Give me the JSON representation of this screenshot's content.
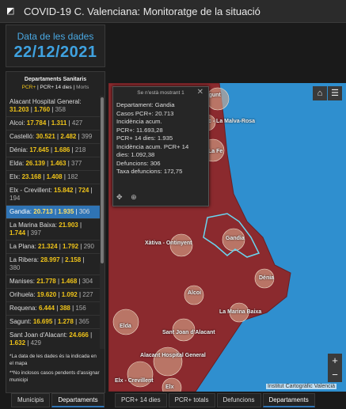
{
  "header": {
    "title": "COVID-19 C. Valenciana: Monitoratge de la situació",
    "logo_icon": "arcgis-logo-icon"
  },
  "date_panel": {
    "label": "Data de les dades",
    "value": "22/12/2021"
  },
  "list_panel": {
    "heading": "Departaments Sanitaris",
    "legend": {
      "pcr": "PCR+",
      "sep1": " | ",
      "pcr14": "PCR+ 14 dies",
      "sep2": " | ",
      "morts": "Morts"
    },
    "rows": [
      {
        "name": "Alacant Hospital General:",
        "a": "31.203",
        "b": "1.760",
        "c": "358"
      },
      {
        "name": "Alcoi:",
        "a": "17.784",
        "b": "1.311",
        "c": "427"
      },
      {
        "name": "Castelló:",
        "a": "30.521",
        "b": "2.482",
        "c": "399"
      },
      {
        "name": "Dénia:",
        "a": "17.645",
        "b": "1.686",
        "c": "218"
      },
      {
        "name": "Elda:",
        "a": "26.139",
        "b": "1.463",
        "c": "377"
      },
      {
        "name": "Elx:",
        "a": "23.168",
        "b": "1.408",
        "c": "182"
      },
      {
        "name": "Elx - Crevillent:",
        "a": "15.842",
        "b": "724",
        "c": "194"
      },
      {
        "name": "Gandia:",
        "a": "20.713",
        "b": "1.935",
        "c": "306"
      },
      {
        "name": "La Marina Baixa:",
        "a": "21.903",
        "b": "1.744",
        "c": "397"
      },
      {
        "name": "La Plana:",
        "a": "21.324",
        "b": "1.792",
        "c": "290"
      },
      {
        "name": "La Ribera:",
        "a": "28.997",
        "b": "2.158",
        "c": "380"
      },
      {
        "name": "Manises:",
        "a": "21.778",
        "b": "1.468",
        "c": "304"
      },
      {
        "name": "Orihuela:",
        "a": "19.620",
        "b": "1.092",
        "c": "227"
      },
      {
        "name": "Requena:",
        "a": "6.444",
        "b": "388",
        "c": "156"
      },
      {
        "name": "Sagunt:",
        "a": "16.695",
        "b": "1.278",
        "c": "365"
      },
      {
        "name": "Sant Joan d'Alacant:",
        "a": "24.666",
        "b": "1.632",
        "c": "429"
      },
      {
        "name": "Torrevieja:",
        "a": "15.716",
        "b": "1.307",
        "c": "187"
      }
    ],
    "selected_index": 7,
    "note1": "*La data de les dades és la indicada en el mapa",
    "note2": "**No inclosos casos pendents d'assignar municipi"
  },
  "left_tabs": [
    "Municipis",
    "Departaments"
  ],
  "map_tabs": [
    "PCR+ 14 dies",
    "PCR+ totals",
    "Defuncions",
    "Departaments"
  ],
  "popup": {
    "header": "Se n'està mostrant 1",
    "lines": [
      "Departament: Gandia",
      "Casos PCR+: 20.713",
      "Incidència acum.",
      "PCR+: 11.693,28",
      "PCR+ 14 dies: 1.935",
      "Incidència acum. PCR+ 14",
      "dies: 1.092,38",
      "Defuncions: 306",
      "Taxa defuncions: 172,75"
    ]
  },
  "map": {
    "labels": [
      "Sagunt",
      "ic - La Malva-Rosa",
      "La Fe",
      "Gandia",
      "Xàtiva - Ontinyent",
      "Dénia",
      "Alcoi",
      "La Marina Baixa",
      "Elda",
      "Sant Joan d'Alacant",
      "Alacant Hospital General",
      "Elx - Crevillent",
      "Elx",
      "Castalla",
      "Orihuela"
    ],
    "attribution": "Institut Cartogràfic Valencià",
    "zoom_in": "+",
    "zoom_out": "−",
    "colors": {
      "region": "#8b2a2e",
      "sea": "#2f8fcf",
      "bubble": "#d9a98c",
      "selected_outline": "#6ad6f0"
    }
  }
}
